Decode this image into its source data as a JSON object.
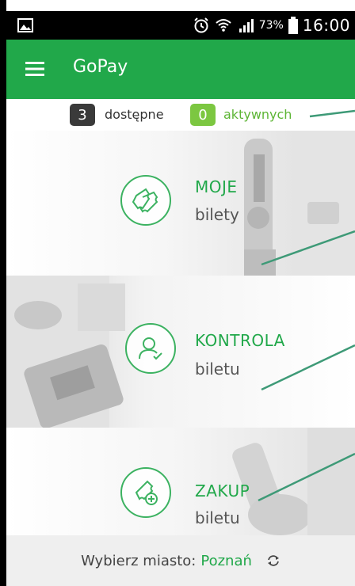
{
  "status_bar": {
    "battery": "73%",
    "time": "16:00",
    "icons": [
      "image-icon",
      "alarm-icon",
      "wifi-icon",
      "signal-icon",
      "battery-icon"
    ]
  },
  "app_bar": {
    "title": "GoPay",
    "menu_icon": "hamburger-menu-icon"
  },
  "counters": {
    "available_count": "3",
    "available_label": "dostępne",
    "active_count": "0",
    "active_label": "aktywnych"
  },
  "tiles": [
    {
      "title": "MOJE",
      "subtitle": "bilety",
      "icon": "tickets-icon"
    },
    {
      "title": "KONTROLA",
      "subtitle": "biletu",
      "icon": "user-check-icon"
    },
    {
      "title": "ZAKUP",
      "subtitle": "biletu",
      "icon": "ticket-add-icon"
    }
  ],
  "bottom_bar": {
    "city_label": "Wybierz miasto:",
    "city": "Poznań",
    "refresh_icon": "refresh-icon"
  },
  "colors": {
    "primary_green": "#21a84a",
    "light_green": "#7cc741",
    "dark_badge": "#3a3a3a",
    "callout_line": "#3e9a77"
  }
}
